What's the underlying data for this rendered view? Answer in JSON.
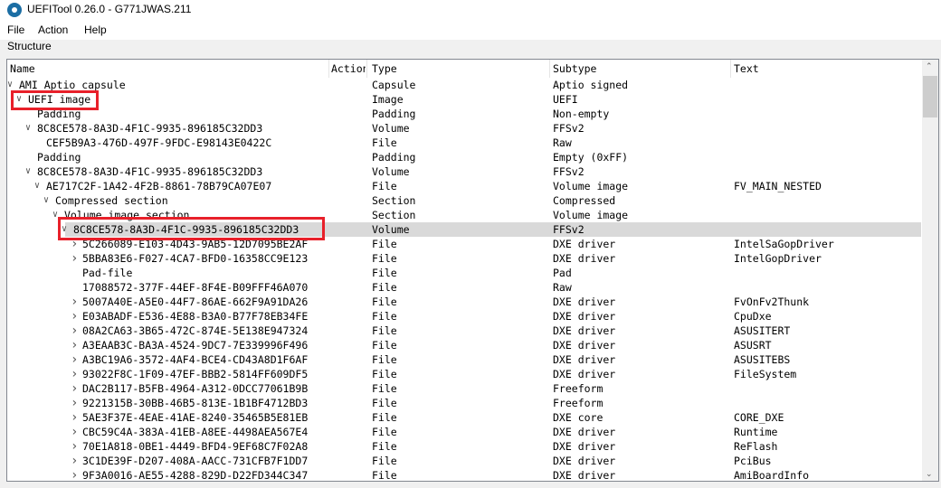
{
  "window": {
    "title": "UEFITool 0.26.0 - G771JWAS.211",
    "icon": "gear-icon"
  },
  "menu": [
    "File",
    "Action",
    "Help"
  ],
  "structure_label": "Structure",
  "columns": [
    "Name",
    "Action",
    "Type",
    "Subtype",
    "Text"
  ],
  "highlight_color": "#e8202a",
  "rows": [
    {
      "name": "AMI Aptio capsule",
      "level": 0,
      "expander": "expanded",
      "type": "Capsule",
      "subtype": "Aptio signed",
      "text": ""
    },
    {
      "name": "UEFI image",
      "level": 1,
      "expander": "expanded",
      "type": "Image",
      "subtype": "UEFI",
      "text": "",
      "highlighted": true
    },
    {
      "name": "Padding",
      "level": 2,
      "expander": "none",
      "type": "Padding",
      "subtype": "Non-empty",
      "text": ""
    },
    {
      "name": "8C8CE578-8A3D-4F1C-9935-896185C32DD3",
      "level": 2,
      "expander": "expanded",
      "type": "Volume",
      "subtype": "FFSv2",
      "text": ""
    },
    {
      "name": "CEF5B9A3-476D-497F-9FDC-E98143E0422C",
      "level": 3,
      "expander": "none",
      "type": "File",
      "subtype": "Raw",
      "text": ""
    },
    {
      "name": "Padding",
      "level": 2,
      "expander": "none",
      "type": "Padding",
      "subtype": "Empty (0xFF)",
      "text": ""
    },
    {
      "name": "8C8CE578-8A3D-4F1C-9935-896185C32DD3",
      "level": 2,
      "expander": "expanded",
      "type": "Volume",
      "subtype": "FFSv2",
      "text": ""
    },
    {
      "name": "AE717C2F-1A42-4F2B-8861-78B79CA07E07",
      "level": 3,
      "expander": "expanded",
      "type": "File",
      "subtype": "Volume image",
      "text": "FV_MAIN_NESTED"
    },
    {
      "name": "Compressed section",
      "level": 4,
      "expander": "expanded",
      "type": "Section",
      "subtype": "Compressed",
      "text": ""
    },
    {
      "name": "Volume image section",
      "level": 5,
      "expander": "expanded",
      "type": "Section",
      "subtype": "Volume image",
      "text": ""
    },
    {
      "name": "8C8CE578-8A3D-4F1C-9935-896185C32DD3",
      "level": 6,
      "expander": "expanded",
      "type": "Volume",
      "subtype": "FFSv2",
      "text": "",
      "selected": true,
      "highlighted": true
    },
    {
      "name": "5C266089-E103-4D43-9AB5-12D7095BE2AF",
      "level": 7,
      "expander": "collapsed",
      "type": "File",
      "subtype": "DXE driver",
      "text": "IntelSaGopDriver"
    },
    {
      "name": "5BBA83E6-F027-4CA7-BFD0-16358CC9E123",
      "level": 7,
      "expander": "collapsed",
      "type": "File",
      "subtype": "DXE driver",
      "text": "IntelGopDriver"
    },
    {
      "name": "Pad-file",
      "level": 7,
      "expander": "none",
      "type": "File",
      "subtype": "Pad",
      "text": ""
    },
    {
      "name": "17088572-377F-44EF-8F4E-B09FFF46A070",
      "level": 7,
      "expander": "none",
      "type": "File",
      "subtype": "Raw",
      "text": ""
    },
    {
      "name": "5007A40E-A5E0-44F7-86AE-662F9A91DA26",
      "level": 7,
      "expander": "collapsed",
      "type": "File",
      "subtype": "DXE driver",
      "text": "FvOnFv2Thunk"
    },
    {
      "name": "E03ABADF-E536-4E88-B3A0-B77F78EB34FE",
      "level": 7,
      "expander": "collapsed",
      "type": "File",
      "subtype": "DXE driver",
      "text": "CpuDxe"
    },
    {
      "name": "08A2CA63-3B65-472C-874E-5E138E947324",
      "level": 7,
      "expander": "collapsed",
      "type": "File",
      "subtype": "DXE driver",
      "text": "ASUSITERT"
    },
    {
      "name": "A3EAAB3C-BA3A-4524-9DC7-7E339996F496",
      "level": 7,
      "expander": "collapsed",
      "type": "File",
      "subtype": "DXE driver",
      "text": "ASUSRT"
    },
    {
      "name": "A3BC19A6-3572-4AF4-BCE4-CD43A8D1F6AF",
      "level": 7,
      "expander": "collapsed",
      "type": "File",
      "subtype": "DXE driver",
      "text": "ASUSITEBS"
    },
    {
      "name": "93022F8C-1F09-47EF-BBB2-5814FF609DF5",
      "level": 7,
      "expander": "collapsed",
      "type": "File",
      "subtype": "DXE driver",
      "text": "FileSystem"
    },
    {
      "name": "DAC2B117-B5FB-4964-A312-0DCC77061B9B",
      "level": 7,
      "expander": "collapsed",
      "type": "File",
      "subtype": "Freeform",
      "text": ""
    },
    {
      "name": "9221315B-30BB-46B5-813E-1B1BF4712BD3",
      "level": 7,
      "expander": "collapsed",
      "type": "File",
      "subtype": "Freeform",
      "text": ""
    },
    {
      "name": "5AE3F37E-4EAE-41AE-8240-35465B5E81EB",
      "level": 7,
      "expander": "collapsed",
      "type": "File",
      "subtype": "DXE core",
      "text": "CORE_DXE"
    },
    {
      "name": "CBC59C4A-383A-41EB-A8EE-4498AEA567E4",
      "level": 7,
      "expander": "collapsed",
      "type": "File",
      "subtype": "DXE driver",
      "text": "Runtime"
    },
    {
      "name": "70E1A818-0BE1-4449-BFD4-9EF68C7F02A8",
      "level": 7,
      "expander": "collapsed",
      "type": "File",
      "subtype": "DXE driver",
      "text": "ReFlash"
    },
    {
      "name": "3C1DE39F-D207-408A-AACC-731CFB7F1DD7",
      "level": 7,
      "expander": "collapsed",
      "type": "File",
      "subtype": "DXE driver",
      "text": "PciBus"
    },
    {
      "name": "9F3A0016-AE55-4288-829D-D22FD344C347",
      "level": 7,
      "expander": "collapsed",
      "type": "File",
      "subtype": "DXE driver",
      "text": "AmiBoardInfo"
    }
  ]
}
